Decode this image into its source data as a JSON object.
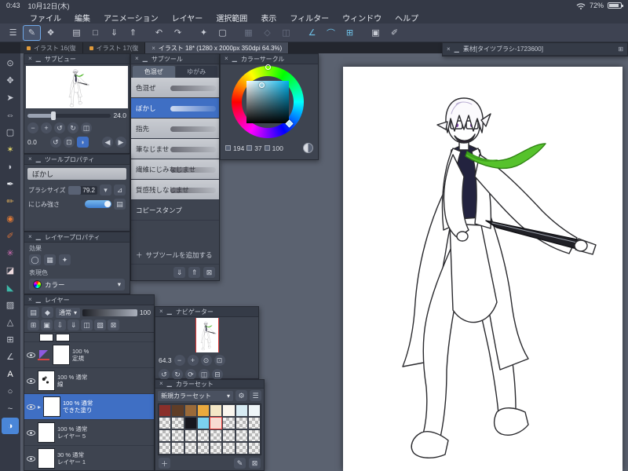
{
  "status_bar": {
    "time": "0:43",
    "date": "10月12日(木)",
    "battery_percent": "72%"
  },
  "menu_bar": {
    "items": [
      "ファイル",
      "編集",
      "アニメーション",
      "レイヤー",
      "選択範囲",
      "表示",
      "フィルター",
      "ウィンドウ",
      "ヘルプ"
    ]
  },
  "toolbar": {
    "icons": [
      {
        "name": "main-menu-icon",
        "glyph": "☰"
      },
      {
        "name": "edit-mode-icon",
        "glyph": "✎",
        "selected": true
      },
      {
        "name": "gesture-icon",
        "glyph": "❖"
      },
      {
        "name": "new-canvas-icon",
        "glyph": "▤",
        "gap": true
      },
      {
        "name": "open-file-icon",
        "glyph": "□"
      },
      {
        "name": "save-icon",
        "glyph": "⇓"
      },
      {
        "name": "export-icon",
        "glyph": "⇑"
      },
      {
        "name": "undo-icon",
        "glyph": "↶",
        "gap": true
      },
      {
        "name": "redo-icon",
        "glyph": "↷"
      },
      {
        "name": "clear-icon",
        "glyph": "✦",
        "gap": true
      },
      {
        "name": "transform-icon",
        "glyph": "▢"
      },
      {
        "name": "deselect-icon",
        "glyph": "▦",
        "disabled": true,
        "gap": true
      },
      {
        "name": "invert-selection-icon",
        "glyph": "◇",
        "disabled": true
      },
      {
        "name": "crop-icon",
        "glyph": "◫",
        "disabled": true
      },
      {
        "name": "snap-ruler-icon",
        "glyph": "∠",
        "accent": true,
        "gap": true
      },
      {
        "name": "snap-special-ruler-icon",
        "glyph": "⌒",
        "accent": true
      },
      {
        "name": "snap-grid-icon",
        "glyph": "⊞",
        "accent": true
      },
      {
        "name": "material-palette-icon",
        "glyph": "▣",
        "gap": true
      },
      {
        "name": "quick-access-icon",
        "glyph": "✐"
      }
    ]
  },
  "tabs": [
    {
      "label": "イラスト 16(復",
      "dot": true
    },
    {
      "label": "イラスト 17(復",
      "dot": true
    },
    {
      "label": "イラスト 18* (1280 x 2000px 350dpi 64.3%)",
      "active": true,
      "close": "×"
    }
  ],
  "material_palette": {
    "title": "素材[タイツブラシ-1723600]"
  },
  "tool_strip": {
    "tools": [
      {
        "name": "zoom-tool",
        "glyph": "⊙",
        "color": "#c9cdd6"
      },
      {
        "name": "move-tool",
        "glyph": "✥",
        "color": "#c9cdd6"
      },
      {
        "name": "operation-tool",
        "glyph": "➤",
        "color": "#c9cdd6"
      },
      {
        "name": "layer-move-tool",
        "glyph": "⇔",
        "color": "#c9cdd6"
      },
      {
        "name": "selection-tool",
        "glyph": "▢",
        "color": "#c9cdd6"
      },
      {
        "name": "auto-select-tool",
        "glyph": "✶",
        "color": "#e5d96a"
      },
      {
        "name": "eyedropper-tool",
        "glyph": "◗",
        "color": "#c9cdd6"
      },
      {
        "name": "pen-tool",
        "glyph": "✒",
        "color": "#eceff4"
      },
      {
        "name": "pencil-tool",
        "glyph": "✏",
        "color": "#e2b05c"
      },
      {
        "name": "airbrush-tool",
        "glyph": "◉",
        "color": "#e07a36"
      },
      {
        "name": "brush-tool",
        "glyph": "✐",
        "color": "#d2703a"
      },
      {
        "name": "decoration-tool",
        "glyph": "✳",
        "color": "#d870b8"
      },
      {
        "name": "eraser-tool",
        "glyph": "◪",
        "color": "#f0dce0"
      },
      {
        "name": "fill-tool",
        "glyph": "◣",
        "color": "#3db8a8"
      },
      {
        "name": "gradient-tool",
        "glyph": "▨",
        "color": "#c9cdd6"
      },
      {
        "name": "figure-tool",
        "glyph": "△",
        "color": "#c9cdd6"
      },
      {
        "name": "frame-border-tool",
        "glyph": "⊞",
        "color": "#c9cdd6"
      },
      {
        "name": "ruler-tool",
        "glyph": "∠",
        "color": "#c9cdd6"
      },
      {
        "name": "text-tool",
        "glyph": "A",
        "color": "#ffffff"
      },
      {
        "name": "balloon-tool",
        "glyph": "○",
        "color": "#c9cdd6"
      },
      {
        "name": "correction-tool",
        "glyph": "~",
        "color": "#c9cdd6"
      },
      {
        "name": "blend-tool",
        "glyph": "◑",
        "color": "#ffffff",
        "selected": true
      }
    ]
  },
  "subview": {
    "title": "サブビュー",
    "zoom_value": "24.0",
    "angle_value": "0.0"
  },
  "subtool": {
    "title": "サブツール",
    "tabs": [
      {
        "label": "色混ぜ",
        "selected": true
      },
      {
        "label": "ゆがみ"
      }
    ],
    "items": [
      {
        "label": "色混ぜ",
        "preview": true
      },
      {
        "label": "ぼかし",
        "preview": true,
        "selected": true
      },
      {
        "label": "指先",
        "preview": true
      },
      {
        "label": "筆なじませ",
        "preview": true
      },
      {
        "label": "繊維にじみなじませ",
        "preview": true
      },
      {
        "label": "質感残しなじませ",
        "preview": true
      },
      {
        "label": "コピースタンプ",
        "preview": false
      }
    ],
    "add_label": "サブツールを追加する"
  },
  "color_circle": {
    "title": "カラーサークル",
    "hue": "194",
    "saturation": "37",
    "value": "100"
  },
  "tool_property": {
    "title": "ツールプロパティ",
    "tool_name": "ぼかし",
    "brush_size_label": "ブラシサイズ",
    "brush_size_value": "79.2",
    "strength_label": "にじみ強さ"
  },
  "layer_property": {
    "title": "レイヤープロパティ",
    "effect_label": "効果",
    "expression_label": "表現色",
    "color_button_label": "カラー"
  },
  "layers": {
    "title": "レイヤー",
    "blend_mode": "通常",
    "opacity_value": "100",
    "rows": [
      {
        "partial": true
      },
      {
        "opacity": "100 %",
        "mode": "",
        "name": "定規",
        "eye": true,
        "icon": "ruler"
      },
      {
        "opacity": "100 %",
        "mode": "通常",
        "name": "線",
        "eye": true,
        "scribble": true
      },
      {
        "opacity": "100 %",
        "mode": "通常",
        "name": "できた塗り",
        "eye": true,
        "selected": true,
        "arrow": true,
        "checker": true
      },
      {
        "opacity": "100 %",
        "mode": "通常",
        "name": "レイヤー 5",
        "eye": true
      },
      {
        "opacity": "30 %",
        "mode": "通常",
        "name": "レイヤー 1",
        "eye": true,
        "checker": true
      }
    ]
  },
  "navigator": {
    "title": "ナビゲーター",
    "zoom_value": "64.3"
  },
  "color_set": {
    "title": "カラーセット",
    "preset_name": "新規カラーセット",
    "selected_cell": {
      "row": 1,
      "col": 4
    },
    "swatches": [
      [
        "#8a2f2a",
        "#5f3d27",
        "#9a6a39",
        "#eaa93e",
        "#f4e7c6",
        "#faf6ee",
        "#d8ecf4",
        "#eef5f8"
      ],
      [
        "checker",
        "checker",
        "#17171f",
        "#7cd0ef",
        "#f7dcd2",
        "checker",
        "checker",
        "checker"
      ],
      [
        "checker",
        "checker",
        "checker",
        "checker",
        "checker",
        "checker",
        "checker",
        "checker"
      ],
      [
        "checker",
        "checker",
        "checker",
        "checker",
        "checker",
        "checker",
        "checker",
        "checker"
      ]
    ]
  },
  "colors": {
    "accent_blue": "#3f6fc4",
    "selection_red": "#e03a3a",
    "tie_green": "#56c22c"
  }
}
